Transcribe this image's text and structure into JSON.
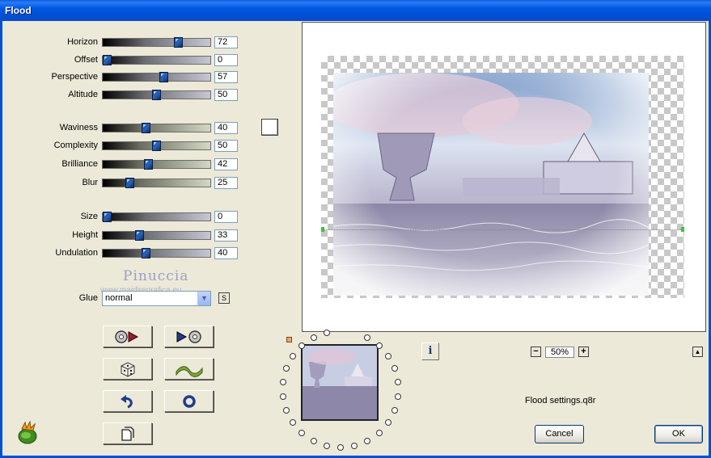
{
  "window": {
    "title": "Flood"
  },
  "sliders": {
    "horizon": {
      "label": "Horizon",
      "value": "72"
    },
    "offset": {
      "label": "Offset",
      "value": "0"
    },
    "perspective": {
      "label": "Perspective",
      "value": "57"
    },
    "altitude": {
      "label": "Altitude",
      "value": "50"
    },
    "waviness": {
      "label": "Waviness",
      "value": "40"
    },
    "complexity": {
      "label": "Complexity",
      "value": "50"
    },
    "brilliance": {
      "label": "Brilliance",
      "value": "42"
    },
    "blur": {
      "label": "Blur",
      "value": "25"
    },
    "size": {
      "label": "Size",
      "value": "0"
    },
    "height": {
      "label": "Height",
      "value": "33"
    },
    "undulation": {
      "label": "Undulation",
      "value": "40"
    }
  },
  "watermark": {
    "name": "Pinuccia",
    "url": "www.maidiregrafica.eu"
  },
  "glue": {
    "label": "Glue",
    "value": "normal",
    "s_button": "S"
  },
  "tool_buttons": {
    "prev_preset_icon": "disc-arrow-right-icon",
    "next_preset_icon": "arrow-disc-icon",
    "random_icon": "dice-icon",
    "wave_icon": "wave-icon",
    "undo_icon": "undo-arrow-icon",
    "reset_icon": "ring-icon",
    "copy_icon": "document-icon"
  },
  "preview": {
    "zoom": "50%",
    "zoom_minus": "−",
    "zoom_plus": "+",
    "info_label": "i",
    "collapse_label": "▲"
  },
  "status": {
    "settings_file": "Flood settings.q8r"
  },
  "buttons": {
    "cancel": "Cancel",
    "ok": "OK"
  },
  "colors": {
    "titlebar": "#0058e2",
    "background": "#ece9d8",
    "thumb": "#1b4c94",
    "flood_color": "#ffffff"
  }
}
